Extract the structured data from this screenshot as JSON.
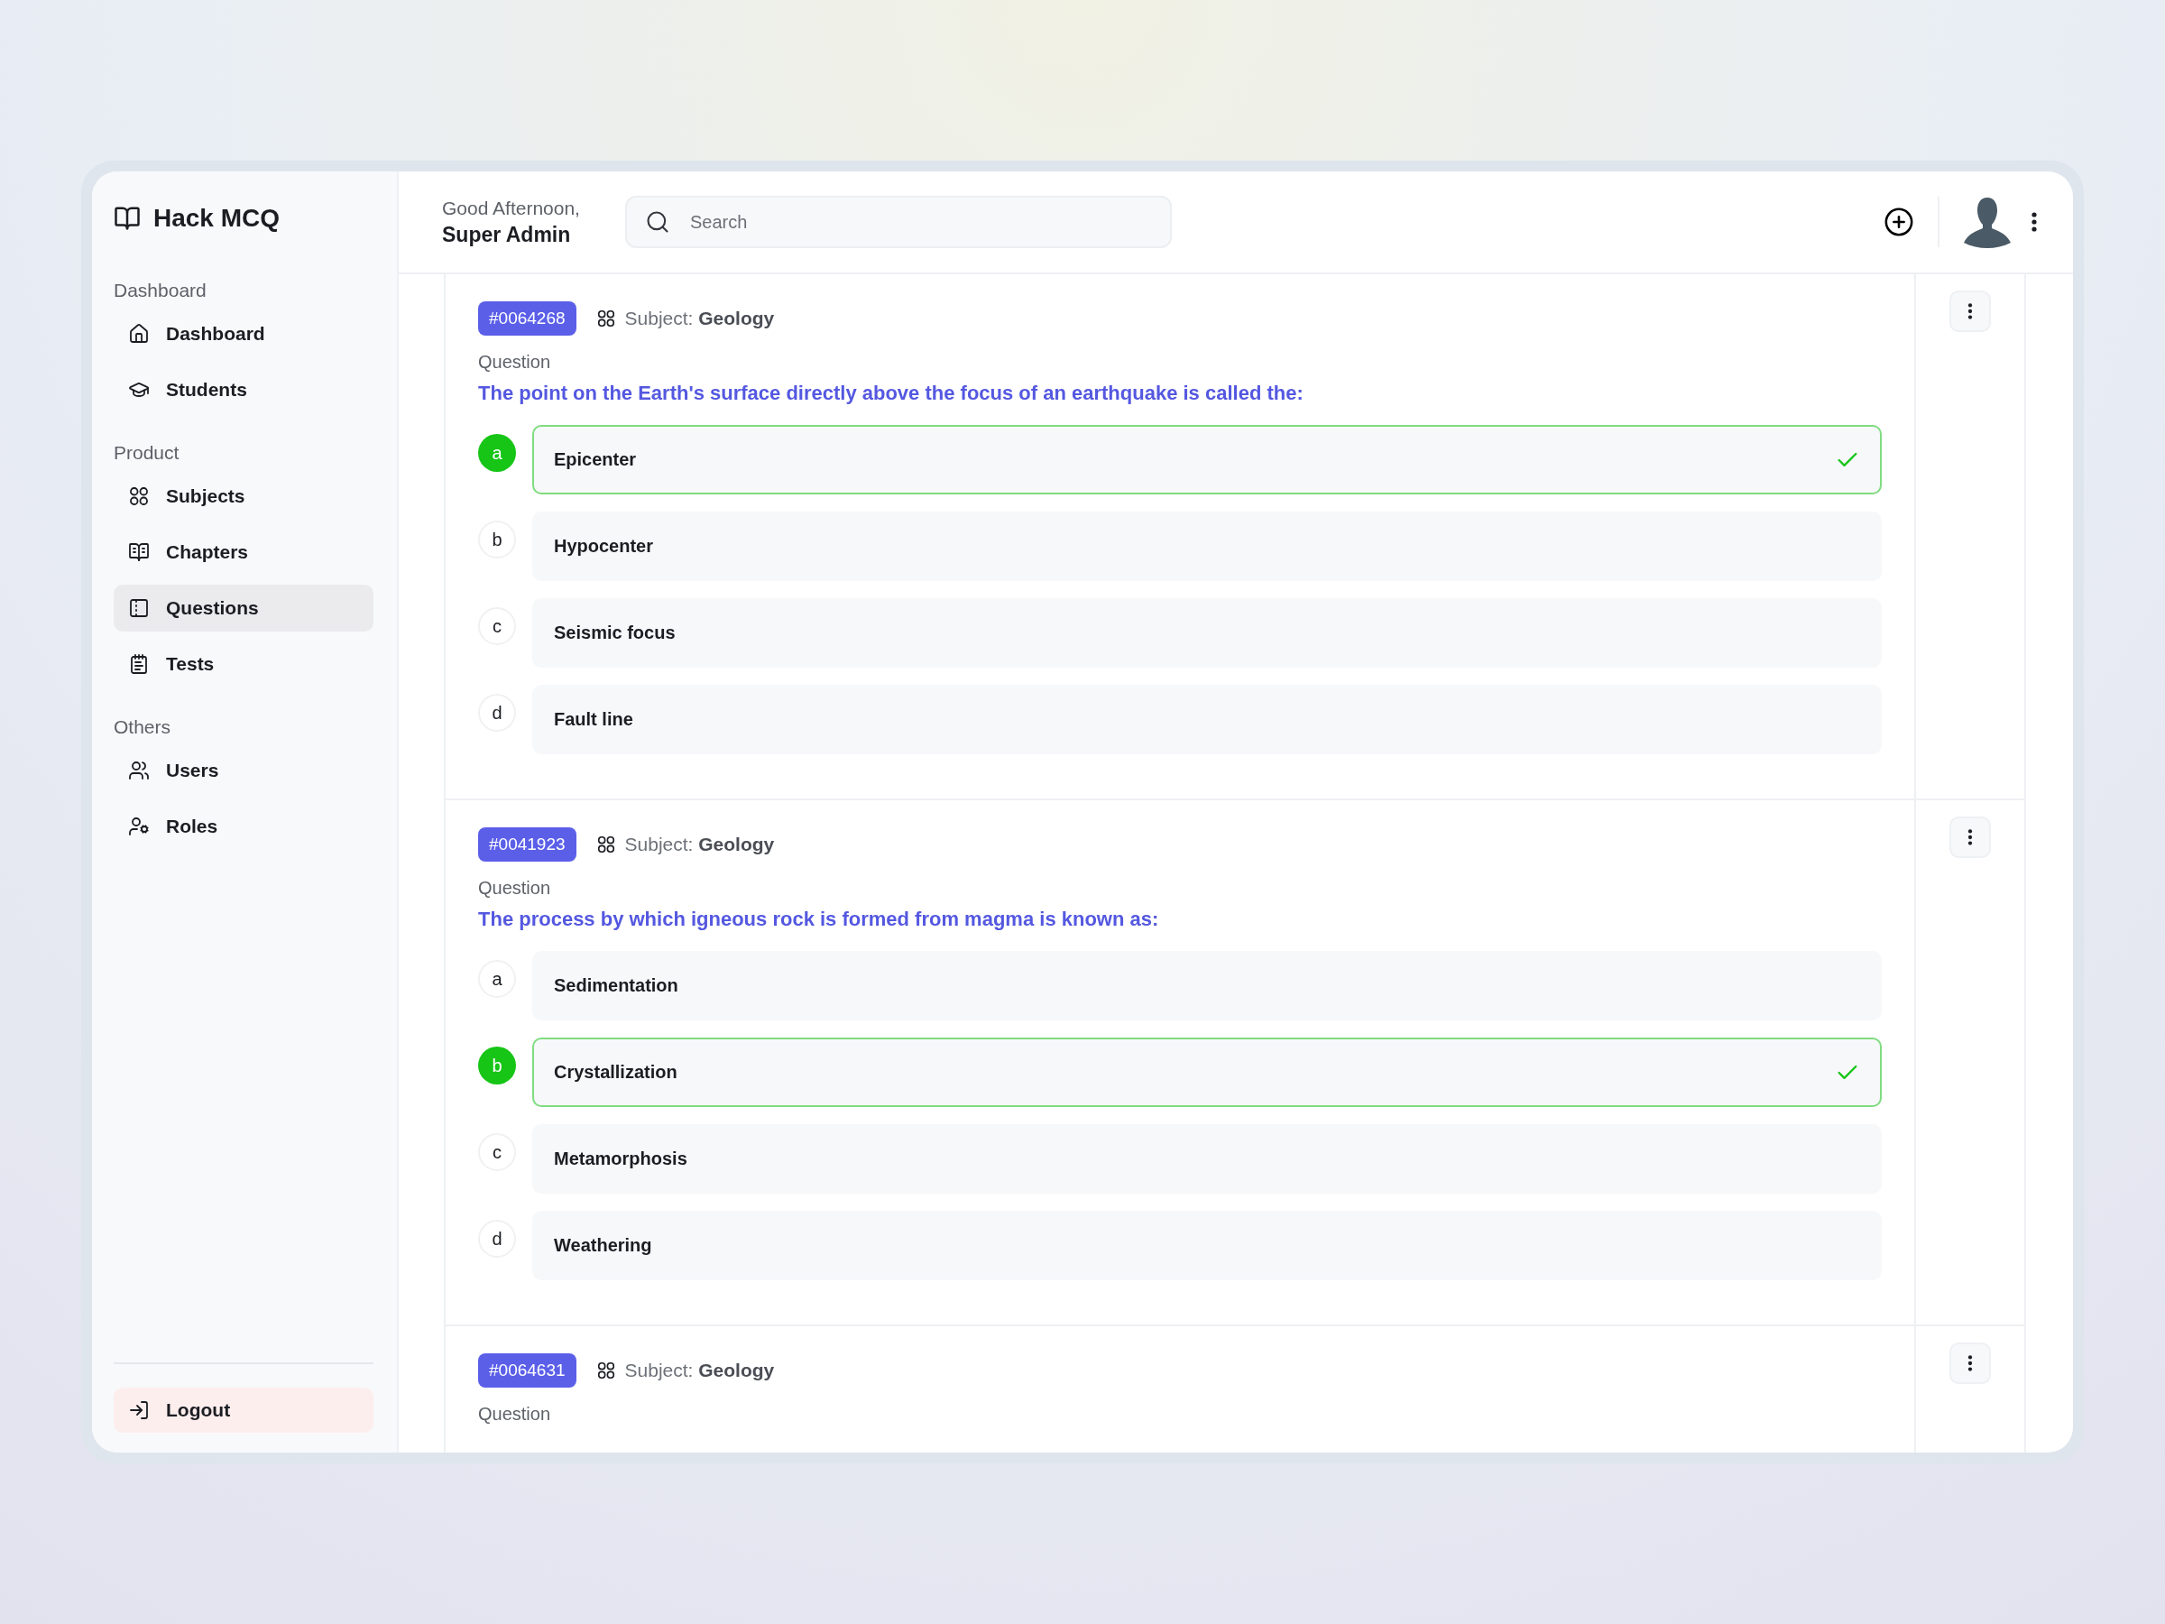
{
  "brand": {
    "name": "Hack MCQ"
  },
  "header": {
    "greeting": "Good Afternoon,",
    "user_name": "Super Admin",
    "search": {
      "placeholder": "Search"
    }
  },
  "sidebar": {
    "sections": [
      {
        "title": "Dashboard",
        "items": [
          {
            "label": "Dashboard",
            "selected": false
          },
          {
            "label": "Students",
            "selected": false
          }
        ]
      },
      {
        "title": "Product",
        "items": [
          {
            "label": "Subjects",
            "selected": false
          },
          {
            "label": "Chapters",
            "selected": false
          },
          {
            "label": "Questions",
            "selected": true
          },
          {
            "label": "Tests",
            "selected": false
          }
        ]
      },
      {
        "title": "Others",
        "items": [
          {
            "label": "Users",
            "selected": false
          },
          {
            "label": "Roles",
            "selected": false
          }
        ]
      }
    ],
    "logout": "Logout"
  },
  "questions": [
    {
      "id": "#0064268",
      "subject": "Subject: **Geology**",
      "question_label": "Question",
      "text": "The point on the Earth's surface directly above the focus of an earthquake is called the:",
      "options": [
        {
          "letter": "a",
          "text": "Epicenter",
          "correct": true
        },
        {
          "letter": "b",
          "text": "Hypocenter",
          "correct": false
        },
        {
          "letter": "c",
          "text": "Seismic focus",
          "correct": false
        },
        {
          "letter": "d",
          "text": "Fault line",
          "correct": false
        }
      ]
    },
    {
      "id": "#0041923",
      "subject": "Subject: **Geology**",
      "question_label": "Question",
      "text": "The process by which igneous rock is formed from magma is known as:",
      "options": [
        {
          "letter": "a",
          "text": "Sedimentation",
          "correct": false
        },
        {
          "letter": "b",
          "text": "Crystallization",
          "correct": true
        },
        {
          "letter": "c",
          "text": "Metamorphosis",
          "correct": false
        },
        {
          "letter": "d",
          "text": "Weathering",
          "correct": false
        }
      ]
    },
    {
      "id": "#0064631",
      "subject": "Subject: **Geology**",
      "question_label": "Question"
    }
  ]
}
